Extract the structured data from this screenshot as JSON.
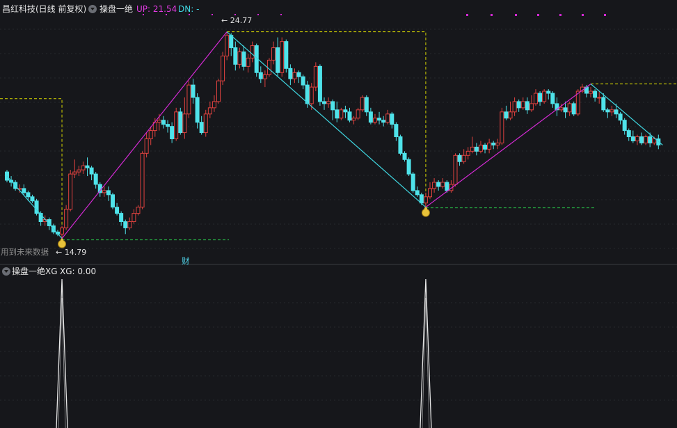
{
  "header": {
    "stock_title": "昌红科技(日线 前复权)",
    "indicator_name": "操盘一绝",
    "up_label": "UP: 21.54",
    "dn_label": "DN: -"
  },
  "sub_header": {
    "indicator_name": "操盘一绝XG",
    "xg_label": "XG: 0.00"
  },
  "annotations": {
    "high_label": "24.77",
    "low_label": "14.79",
    "future_data_note": "用到未来数据",
    "cai_marker": "财"
  },
  "colors": {
    "background": "#16171b",
    "up_candle": "#e0423f",
    "down_candle": "#4fe3ea",
    "rise_line": "#d42ad4",
    "fall_line": "#3fd6e0",
    "support": "#29c34a",
    "resistance": "#d8d800",
    "signal": "#e8e8e8"
  },
  "chart_data": [
    {
      "type": "candlestick",
      "title": "昌红科技(日线 前复权)",
      "ylim": [
        13.6,
        25.7
      ],
      "up_value": 21.54,
      "zigzag_points": [
        {
          "bar": 0,
          "price": 17.8
        },
        {
          "bar": 13,
          "price": 14.79
        },
        {
          "bar": 52,
          "price": 24.77
        },
        {
          "bar": 99,
          "price": 16.3
        },
        {
          "bar": 138,
          "price": 22.25
        },
        {
          "bar": 155,
          "price": 19.3
        }
      ],
      "buy_signals_bar": [
        13,
        99
      ],
      "candles": [
        [
          18.0,
          17.6,
          18.1,
          17.5
        ],
        [
          17.6,
          17.5,
          17.8,
          17.3
        ],
        [
          17.5,
          17.2,
          17.6,
          17.1
        ],
        [
          17.2,
          17.2,
          17.4,
          17.0
        ],
        [
          17.2,
          17.0,
          17.4,
          16.9
        ],
        [
          17.0,
          16.8,
          17.1,
          16.6
        ],
        [
          16.8,
          16.6,
          16.9,
          16.5
        ],
        [
          16.6,
          16.0,
          16.7,
          15.9
        ],
        [
          16.0,
          15.6,
          16.1,
          15.4
        ],
        [
          15.6,
          15.7,
          15.9,
          15.4
        ],
        [
          15.7,
          15.4,
          15.8,
          15.2
        ],
        [
          15.4,
          15.1,
          15.5,
          15.0
        ],
        [
          15.1,
          15.0,
          15.2,
          14.9
        ],
        [
          15.0,
          15.3,
          15.4,
          14.79
        ],
        [
          15.3,
          16.2,
          16.4,
          15.2
        ],
        [
          16.2,
          17.9,
          18.1,
          16.1
        ],
        [
          17.9,
          18.0,
          18.6,
          17.7
        ],
        [
          18.0,
          18.1,
          18.3,
          17.8
        ],
        [
          18.1,
          18.3,
          18.5,
          17.9
        ],
        [
          18.3,
          18.2,
          18.7,
          17.8
        ],
        [
          18.2,
          17.9,
          18.3,
          17.6
        ],
        [
          17.9,
          17.4,
          18.0,
          17.2
        ],
        [
          17.4,
          17.0,
          17.5,
          16.8
        ],
        [
          17.0,
          17.1,
          17.3,
          16.8
        ],
        [
          17.1,
          16.9,
          17.3,
          16.6
        ],
        [
          16.9,
          16.3,
          17.0,
          16.2
        ],
        [
          16.3,
          16.0,
          16.5,
          15.9
        ],
        [
          16.0,
          15.6,
          16.1,
          15.4
        ],
        [
          15.6,
          15.3,
          15.7,
          15.0
        ],
        [
          15.3,
          15.6,
          15.8,
          15.2
        ],
        [
          15.6,
          16.0,
          16.2,
          15.5
        ],
        [
          16.0,
          16.3,
          16.4,
          15.9
        ],
        [
          16.3,
          18.9,
          19.0,
          16.2
        ],
        [
          18.9,
          19.6,
          19.9,
          18.7
        ],
        [
          19.6,
          20.0,
          20.2,
          19.3
        ],
        [
          20.0,
          20.4,
          20.6,
          19.7
        ],
        [
          20.4,
          20.5,
          20.8,
          20.0
        ],
        [
          20.5,
          20.3,
          20.7,
          20.1
        ],
        [
          20.3,
          20.2,
          20.5,
          19.9
        ],
        [
          20.2,
          19.6,
          20.4,
          19.4
        ],
        [
          19.6,
          20.9,
          21.1,
          19.5
        ],
        [
          20.9,
          19.9,
          21.1,
          19.8
        ],
        [
          19.9,
          20.8,
          21.6,
          19.6
        ],
        [
          20.8,
          22.2,
          22.4,
          20.6
        ],
        [
          22.2,
          21.6,
          22.5,
          21.3
        ],
        [
          21.6,
          20.4,
          21.8,
          20.1
        ],
        [
          20.4,
          19.9,
          20.7,
          19.8
        ],
        [
          19.9,
          20.8,
          21.0,
          19.7
        ],
        [
          20.8,
          21.1,
          21.4,
          20.6
        ],
        [
          21.1,
          21.4,
          21.7,
          20.9
        ],
        [
          21.4,
          22.4,
          22.5,
          21.3
        ],
        [
          22.4,
          23.6,
          23.8,
          22.2
        ],
        [
          23.6,
          24.6,
          24.77,
          23.4
        ],
        [
          24.6,
          24.0,
          24.7,
          23.6
        ],
        [
          24.0,
          23.2,
          24.3,
          22.9
        ],
        [
          23.2,
          23.8,
          24.0,
          23.0
        ],
        [
          23.8,
          23.1,
          24.1,
          22.9
        ],
        [
          23.1,
          23.5,
          23.7,
          22.8
        ],
        [
          23.5,
          24.1,
          24.3,
          23.3
        ],
        [
          24.1,
          22.8,
          24.2,
          22.6
        ],
        [
          22.8,
          22.5,
          23.1,
          22.3
        ],
        [
          22.5,
          22.7,
          22.9,
          22.1
        ],
        [
          22.7,
          23.4,
          23.5,
          22.6
        ],
        [
          23.4,
          24.0,
          24.3,
          23.2
        ],
        [
          24.0,
          22.8,
          24.5,
          22.6
        ],
        [
          22.8,
          24.3,
          24.5,
          22.6
        ],
        [
          24.3,
          23.0,
          24.4,
          22.8
        ],
        [
          23.0,
          22.5,
          23.2,
          22.2
        ],
        [
          22.5,
          22.8,
          23.0,
          22.3
        ],
        [
          22.8,
          22.6,
          22.9,
          22.3
        ],
        [
          22.6,
          22.2,
          22.7,
          22.0
        ],
        [
          22.2,
          21.3,
          22.4,
          21.1
        ],
        [
          21.3,
          22.1,
          22.3,
          21.0
        ],
        [
          22.1,
          23.1,
          23.3,
          21.9
        ],
        [
          23.1,
          21.4,
          23.2,
          21.2
        ],
        [
          21.4,
          21.3,
          21.6,
          21.0
        ],
        [
          21.3,
          21.4,
          21.6,
          21.1
        ],
        [
          21.4,
          21.0,
          21.5,
          20.5
        ],
        [
          21.0,
          20.6,
          21.4,
          20.4
        ],
        [
          20.6,
          21.0,
          21.1,
          20.5
        ],
        [
          21.0,
          20.9,
          21.2,
          20.6
        ],
        [
          20.9,
          20.5,
          21.1,
          20.4
        ],
        [
          20.5,
          20.6,
          20.7,
          20.3
        ],
        [
          20.6,
          21.0,
          21.1,
          20.5
        ],
        [
          21.0,
          21.6,
          21.7,
          20.9
        ],
        [
          21.6,
          20.9,
          21.7,
          20.7
        ],
        [
          20.9,
          20.4,
          21.1,
          20.3
        ],
        [
          20.4,
          20.6,
          20.8,
          20.3
        ],
        [
          20.6,
          20.5,
          20.9,
          20.3
        ],
        [
          20.5,
          20.4,
          20.7,
          20.2
        ],
        [
          20.4,
          20.8,
          21.0,
          20.3
        ],
        [
          20.8,
          20.3,
          20.9,
          20.1
        ],
        [
          20.3,
          19.7,
          20.4,
          19.5
        ],
        [
          19.7,
          18.9,
          19.8,
          18.8
        ],
        [
          18.9,
          18.6,
          19.0,
          18.5
        ],
        [
          18.6,
          17.9,
          18.7,
          17.8
        ],
        [
          17.9,
          17.1,
          18.0,
          17.0
        ],
        [
          17.1,
          16.9,
          17.3,
          16.8
        ],
        [
          16.9,
          16.5,
          17.0,
          16.4
        ],
        [
          16.5,
          16.8,
          17.0,
          16.3
        ],
        [
          16.8,
          17.2,
          17.5,
          16.7
        ],
        [
          17.2,
          17.5,
          17.7,
          17.0
        ],
        [
          17.5,
          17.3,
          17.6,
          17.1
        ],
        [
          17.3,
          17.5,
          17.7,
          17.2
        ],
        [
          17.5,
          17.1,
          17.6,
          17.0
        ],
        [
          17.1,
          17.4,
          17.6,
          17.0
        ],
        [
          17.4,
          18.8,
          18.9,
          17.3
        ],
        [
          18.8,
          18.5,
          18.9,
          18.3
        ],
        [
          18.5,
          18.8,
          19.1,
          18.4
        ],
        [
          18.8,
          19.0,
          19.2,
          18.6
        ],
        [
          19.0,
          19.2,
          19.7,
          18.9
        ],
        [
          19.2,
          19.0,
          19.4,
          18.8
        ],
        [
          19.0,
          19.3,
          19.5,
          18.9
        ],
        [
          19.3,
          19.1,
          19.4,
          18.9
        ],
        [
          19.1,
          19.4,
          19.6,
          18.9
        ],
        [
          19.4,
          19.3,
          19.5,
          19.1
        ],
        [
          19.3,
          19.4,
          19.6,
          19.1
        ],
        [
          19.4,
          20.9,
          21.1,
          19.3
        ],
        [
          20.9,
          20.6,
          21.2,
          20.5
        ],
        [
          20.6,
          20.9,
          21.4,
          20.5
        ],
        [
          20.9,
          21.4,
          21.6,
          20.7
        ],
        [
          21.4,
          21.1,
          21.5,
          20.9
        ],
        [
          21.1,
          21.4,
          21.6,
          21.0
        ],
        [
          21.4,
          21.0,
          21.6,
          20.8
        ],
        [
          21.0,
          21.3,
          21.7,
          20.9
        ],
        [
          21.3,
          21.8,
          22.0,
          21.2
        ],
        [
          21.8,
          21.4,
          21.9,
          21.2
        ],
        [
          21.4,
          21.9,
          22.0,
          21.3
        ],
        [
          21.9,
          21.8,
          22.0,
          21.5
        ],
        [
          21.8,
          21.3,
          21.9,
          21.1
        ],
        [
          21.3,
          21.0,
          21.6,
          20.7
        ],
        [
          21.0,
          21.1,
          21.3,
          20.9
        ],
        [
          21.1,
          20.9,
          21.4,
          20.6
        ],
        [
          20.9,
          21.3,
          21.4,
          20.7
        ],
        [
          21.3,
          20.8,
          21.4,
          20.7
        ],
        [
          20.8,
          21.9,
          22.0,
          20.7
        ],
        [
          21.9,
          22.1,
          22.25,
          21.8
        ],
        [
          22.1,
          21.8,
          22.2,
          21.6
        ],
        [
          21.8,
          21.9,
          22.1,
          21.6
        ],
        [
          21.9,
          21.6,
          22.0,
          21.4
        ],
        [
          21.6,
          21.6,
          21.9,
          21.3
        ],
        [
          21.6,
          21.0,
          21.8,
          20.9
        ],
        [
          21.0,
          20.9,
          21.1,
          20.6
        ],
        [
          20.9,
          21.0,
          21.2,
          20.7
        ],
        [
          21.0,
          20.8,
          21.3,
          20.6
        ],
        [
          20.8,
          20.5,
          20.9,
          20.3
        ],
        [
          20.5,
          20.0,
          20.6,
          19.8
        ],
        [
          20.0,
          19.7,
          20.1,
          19.5
        ],
        [
          19.7,
          19.5,
          20.0,
          19.4
        ],
        [
          19.5,
          19.7,
          19.8,
          19.3
        ],
        [
          19.7,
          19.4,
          19.9,
          19.3
        ],
        [
          19.4,
          19.7,
          19.8,
          19.3
        ],
        [
          19.7,
          19.4,
          19.9,
          19.2
        ],
        [
          19.4,
          19.6,
          19.7,
          19.3
        ],
        [
          19.6,
          19.3,
          19.8,
          19.1
        ]
      ]
    },
    {
      "type": "line",
      "title": "操盘一绝XG",
      "series": [
        {
          "name": "XG",
          "spikes_at_bar": [
            13,
            99
          ],
          "spike_value": 1,
          "baseline": 0
        }
      ]
    }
  ]
}
